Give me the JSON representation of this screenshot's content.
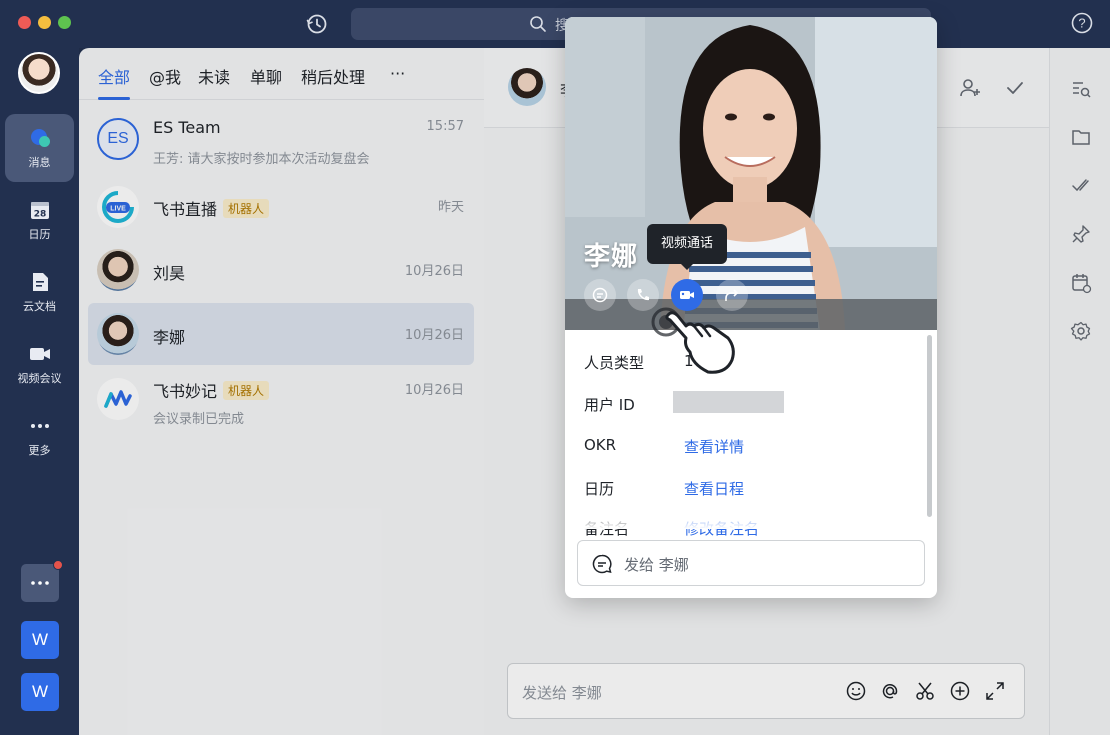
{
  "titlebar": {
    "search_placeholder": "搜"
  },
  "rail": {
    "items": [
      {
        "label": "消息"
      },
      {
        "label": "日历",
        "badge": "28"
      },
      {
        "label": "云文档"
      },
      {
        "label": "视频会议"
      },
      {
        "label": "更多"
      }
    ],
    "apps": [
      {
        "label": "W"
      },
      {
        "label": "W"
      }
    ]
  },
  "tabs": [
    {
      "label": "全部"
    },
    {
      "label": "@我"
    },
    {
      "label": "未读"
    },
    {
      "label": "单聊"
    },
    {
      "label": "稍后处理"
    },
    {
      "label": "···"
    }
  ],
  "conversations": [
    {
      "name": "ES Team",
      "avatar_text": "ES",
      "message": "王芳: 请大家按时参加本次活动复盘会",
      "time": "15:57"
    },
    {
      "name": "飞书直播",
      "avatar_text": "LIVE",
      "tag": "机器人",
      "message": "",
      "time": "昨天"
    },
    {
      "name": "刘昊",
      "message": "",
      "time": "10月26日"
    },
    {
      "name": "李娜",
      "message": "",
      "time": "10月26日"
    },
    {
      "name": "飞书妙记",
      "tag": "机器人",
      "message": "会议录制已完成",
      "time": "10月26日"
    }
  ],
  "main": {
    "header_title_fragment": "李",
    "composer_placeholder": "发送给 李娜"
  },
  "profile": {
    "name": "李娜",
    "tooltip": "视频通话",
    "rows": [
      {
        "label": "人员类型",
        "value": "1"
      },
      {
        "label": "用户 ID",
        "value": ""
      },
      {
        "label": "OKR",
        "value": "查看详情"
      },
      {
        "label": "日历",
        "value": "查看日程"
      },
      {
        "label": "备注名",
        "value": "修改备注名"
      }
    ],
    "send_placeholder": "发给 李娜"
  },
  "colors": {
    "accent": "#2f6be6",
    "rail_bg": "#22304f",
    "bot_tag_bg": "#fbeecb"
  }
}
